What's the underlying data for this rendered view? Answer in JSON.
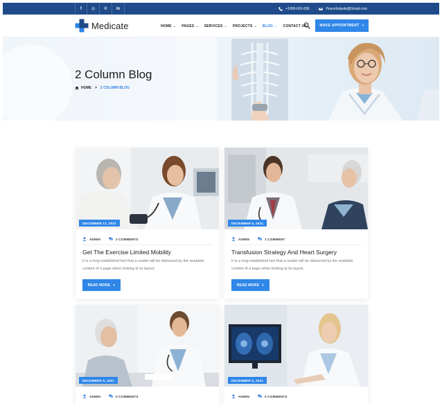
{
  "topbar": {
    "social": [
      {
        "icon": "facebook-icon",
        "glyph": "f"
      },
      {
        "icon": "instagram-icon",
        "glyph": "◎"
      },
      {
        "icon": "pinterest-icon",
        "glyph": "℗"
      },
      {
        "icon": "linkedin-icon",
        "glyph": "in"
      }
    ],
    "phone": "+1800-001-658",
    "email": "Peacefulqode@Gmail.com"
  },
  "nav": {
    "brand": "Medicate",
    "items": [
      {
        "label": "HOME",
        "dropdown": true
      },
      {
        "label": "PAGES",
        "dropdown": true
      },
      {
        "label": "SERVICES",
        "dropdown": true
      },
      {
        "label": "PROJECTS",
        "dropdown": true
      },
      {
        "label": "BLOG",
        "dropdown": true,
        "active": true
      },
      {
        "label": "CONTACT US",
        "dropdown": false
      }
    ],
    "cta_label": "MAKE APPOINTMENT",
    "cta_plus": "+"
  },
  "hero": {
    "title": "2 Column Blog",
    "crumb_home": "HOME",
    "crumb_sep": ">",
    "crumb_current": "2 COLUMN BLOG"
  },
  "posts": [
    {
      "date": "DECEMBER 17, 2021",
      "author": "ADMIN",
      "comments": "2 COMMENTS",
      "title": "Get The Exercise Limited Mobility",
      "excerpt": "It is a long established fact that a reader will be distracted by the readable content of a page when looking at its layout.",
      "button": "READ MORE",
      "button_plus": "+"
    },
    {
      "date": "DECEMBER 5, 2021",
      "author": "ADMIN",
      "comments": "1 COMMENT",
      "title": "Transfusion Strategy And Heart Surgery",
      "excerpt": "It is a long established fact that a reader will be distracted by the readable content of a page when looking at its layout.",
      "button": "READ MORE",
      "button_plus": "+"
    },
    {
      "date": "DECEMBER 5, 2021",
      "author": "ADMIN",
      "comments": "0 COMMENTS"
    },
    {
      "date": "DECEMBER 5, 2021",
      "author": "ADMIN",
      "comments": "0 COMMENTS"
    }
  ],
  "colors": {
    "topbar": "#1f4b8a",
    "accent": "#2f87e8",
    "active_link": "#2f7ee0"
  }
}
